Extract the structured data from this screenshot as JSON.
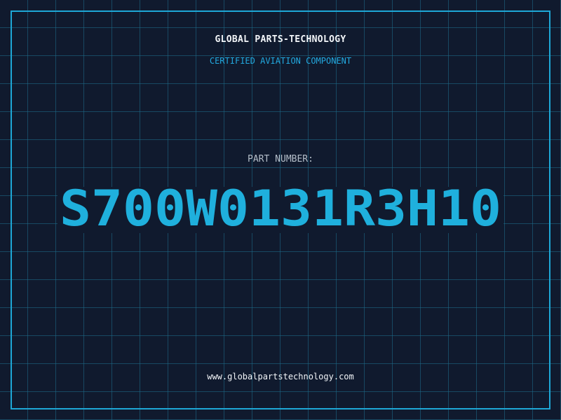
{
  "header": {
    "title": "GLOBAL PARTS-TECHNOLOGY",
    "subtitle": "CERTIFIED AVIATION COMPONENT"
  },
  "part": {
    "label": "PART NUMBER:",
    "number": "S700W0131R3H10"
  },
  "footer": {
    "url": "www.globalpartstechnology.com"
  },
  "colors": {
    "background": "#101a2e",
    "grid": "#1e6e8c",
    "accent": "#1ea7d6",
    "part_number": "#1fb0dd",
    "text_light": "#f2f5f8",
    "text_muted": "#b4bec9"
  }
}
